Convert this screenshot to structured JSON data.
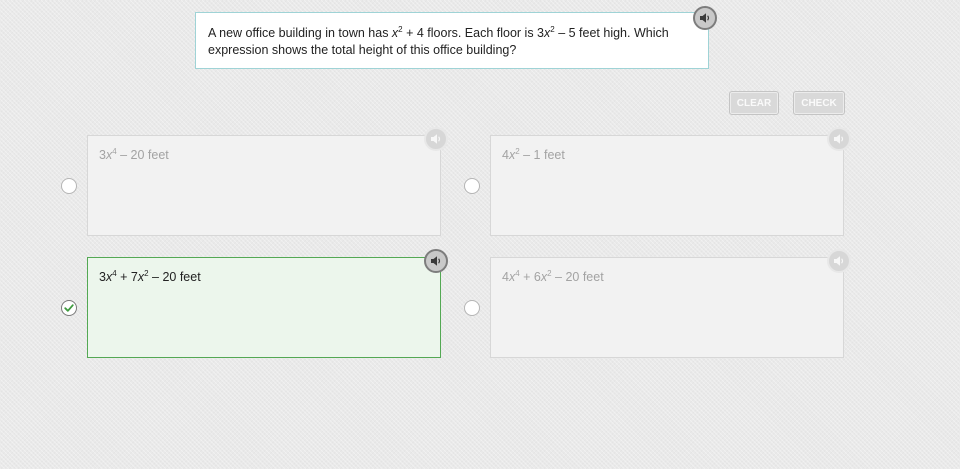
{
  "question": {
    "part1": "A new office building in town has ",
    "var1": "x",
    "exp1": "2",
    "part2": " + 4 floors. Each floor is 3",
    "var2": "x",
    "exp2": "2",
    "part3": " – 5 feet high. Which expression shows the total height of this office building?",
    "audio_icon": "speaker-icon"
  },
  "buttons": {
    "clear": "CLEAR",
    "check": "CHECK"
  },
  "answers": [
    {
      "selected": false,
      "c1": "3",
      "v1": "x",
      "e1": "4",
      "rest": " – 20 feet"
    },
    {
      "selected": false,
      "c1": "4",
      "v1": "x",
      "e1": "2",
      "rest": " – 1 feet"
    },
    {
      "selected": true,
      "c1": "3",
      "v1": "x",
      "e1": "4",
      "mid": " + 7",
      "v2": "x",
      "e2": "2",
      "rest": " – 20 feet"
    },
    {
      "selected": false,
      "c1": "4",
      "v1": "x",
      "e1": "4",
      "mid": " + 6",
      "v2": "x",
      "e2": "2",
      "rest": " – 20 feet"
    }
  ],
  "colors": {
    "selected_border": "#53a853",
    "selected_background": "#ecf6ec",
    "check_mark": "#3f9b3f",
    "question_border": "#9fd3d6"
  }
}
